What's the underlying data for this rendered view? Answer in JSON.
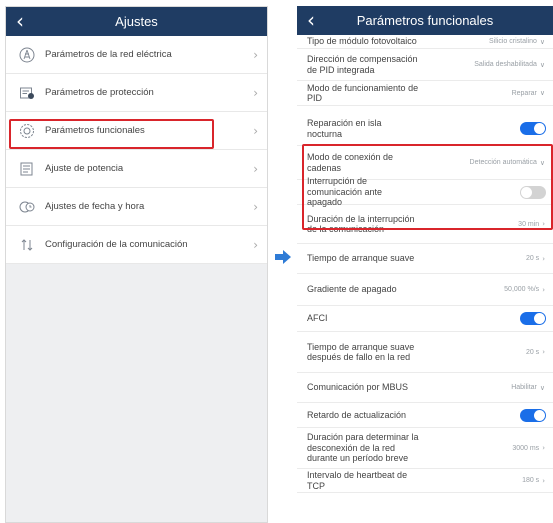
{
  "left": {
    "title": "Ajustes",
    "items": [
      {
        "label": "Parámetros de la red eléctrica",
        "icon": "grid-icon"
      },
      {
        "label": "Parámetros de protección",
        "icon": "protection-icon"
      },
      {
        "label": "Parámetros funcionales",
        "icon": "gear-icon"
      },
      {
        "label": "Ajuste de potencia",
        "icon": "power-icon"
      },
      {
        "label": "Ajustes de fecha y hora",
        "icon": "clock-icon"
      },
      {
        "label": "Configuración de la comunicación",
        "icon": "communication-icon"
      }
    ]
  },
  "right": {
    "title": "Parámetros funcionales",
    "rows": [
      {
        "label": "Tipo de módulo fotovoltaico",
        "value": "Silicio cristalino",
        "kind": "select"
      },
      {
        "label": "Dirección de compensación de PID integrada",
        "value": "Salida deshabilitada",
        "kind": "select"
      },
      {
        "label": "Modo de funcionamiento de PID",
        "value": "Reparar",
        "kind": "select"
      },
      {
        "label": "Reparación en isla nocturna",
        "value": "on",
        "kind": "toggle"
      },
      {
        "label": "Modo de conexión de cadenas",
        "value": "Detección automática",
        "kind": "select"
      },
      {
        "label": "Interrupción de comunicación ante apagado",
        "value": "off",
        "kind": "toggle"
      },
      {
        "label": "Duración de la interrupción de la comunicación",
        "value": "30 min",
        "kind": "link"
      },
      {
        "label": "Tiempo de arranque suave",
        "value": "20 s",
        "kind": "link"
      },
      {
        "label": "Gradiente de apagado",
        "value": "50,000 %/s",
        "kind": "link"
      },
      {
        "label": "AFCI",
        "value": "on",
        "kind": "toggle"
      },
      {
        "label": "Tiempo de arranque suave después de fallo en la red",
        "value": "20 s",
        "kind": "link"
      },
      {
        "label": "Comunicación por MBUS",
        "value": "Habilitar",
        "kind": "select"
      },
      {
        "label": "Retardo de actualización",
        "value": "on",
        "kind": "toggle"
      },
      {
        "label": "Duración para determinar la desconexión de la red durante un período breve",
        "value": "3000 ms",
        "kind": "link"
      },
      {
        "label": "Intervalo de heartbeat de TCP",
        "value": "180 s",
        "kind": "link"
      }
    ]
  },
  "colors": {
    "header": "#1f3c63",
    "accent": "#1a6ee8",
    "highlight": "#d9252b"
  }
}
